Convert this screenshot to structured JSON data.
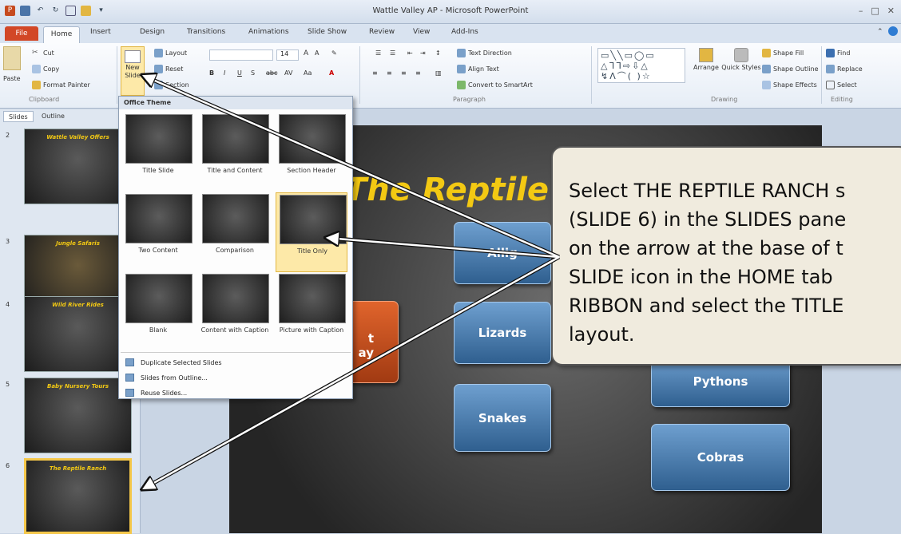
{
  "window": {
    "title": "Wattle Valley AP - Microsoft PowerPoint"
  },
  "tabs": [
    "File",
    "Home",
    "Insert",
    "Design",
    "Transitions",
    "Animations",
    "Slide Show",
    "Review",
    "View",
    "Add-Ins"
  ],
  "ribbon": {
    "clipboard": {
      "cut": "Cut",
      "copy": "Copy",
      "paste": "Paste",
      "format_painter": "Format Painter",
      "label": "Clipboard"
    },
    "slides": {
      "new_slide_1": "New",
      "new_slide_2": "Slide",
      "layout": "Layout",
      "reset": "Reset",
      "section": "Section"
    },
    "font": {
      "size": "14"
    },
    "paragraph": {
      "text_direction": "Text Direction",
      "align_text": "Align Text",
      "smartart": "Convert to SmartArt",
      "label": "Paragraph"
    },
    "drawing": {
      "arrange": "Arrange",
      "quick_styles": "Quick Styles",
      "shape_fill": "Shape Fill",
      "shape_outline": "Shape Outline",
      "shape_effects": "Shape Effects",
      "label": "Drawing"
    },
    "editing": {
      "find": "Find",
      "replace": "Replace",
      "select": "Select",
      "label": "Editing"
    }
  },
  "panel": {
    "tabs": [
      "Slides",
      "Outline"
    ],
    "thumbs": [
      {
        "num": "2",
        "title": "Wattle Valley Offers"
      },
      {
        "num": "3",
        "title": "Jungle Safaris"
      },
      {
        "num": "4",
        "title": "Wild River Rides"
      },
      {
        "num": "5",
        "title": "Baby Nursery Tours"
      },
      {
        "num": "6",
        "title": "The Reptile Ranch"
      }
    ]
  },
  "gallery": {
    "header": "Office Theme",
    "layouts": [
      {
        "label": "Title Slide"
      },
      {
        "label": "Title and Content"
      },
      {
        "label": "Section Header"
      },
      {
        "label": "Two Content"
      },
      {
        "label": "Comparison"
      },
      {
        "label": "Title Only"
      },
      {
        "label": "Blank"
      },
      {
        "label": "Content with Caption"
      },
      {
        "label": "Picture with Caption"
      }
    ],
    "menu": [
      "Duplicate Selected Slides",
      "Slides from Outline...",
      "Reuse Slides..."
    ]
  },
  "slide": {
    "title": "The Reptile",
    "nodes": {
      "alligators": "Allig",
      "lizards": "Lizards",
      "snakes": "Snakes",
      "pythons": "Pythons",
      "cobras": "Cobras",
      "day_1": "t",
      "day_2": "ay"
    }
  },
  "callout": {
    "text": "Select THE REPTILE RANCH s\n(SLIDE 6) in the SLIDES pane\non the arrow at the base of t\nSLIDE icon in the HOME tab\nRIBBON and select the TITLE\nlayout."
  }
}
